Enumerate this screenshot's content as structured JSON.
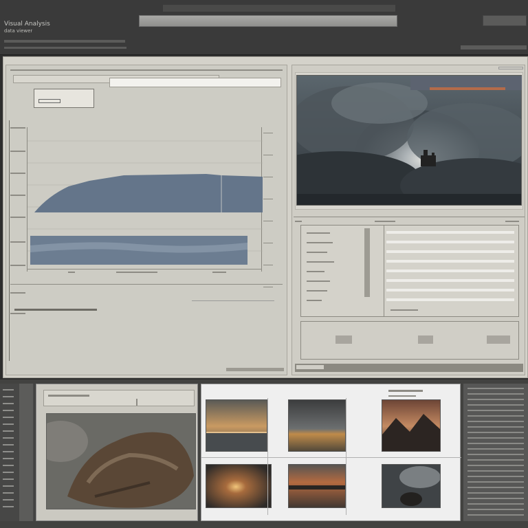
{
  "app": {
    "title": "Visual Analysis",
    "subtitle": "data viewer"
  },
  "toolbar": {
    "search_placeholder": "",
    "right_label": ""
  },
  "left_panel": {
    "header": "",
    "filter_label": "",
    "chart": {
      "caption": "",
      "bottom_label": ""
    }
  },
  "right_panel": {
    "preview_label": "",
    "table": {
      "headers": [
        "",
        "",
        ""
      ],
      "rows": [
        {
          "label": "",
          "value": ""
        },
        {
          "label": "",
          "value": ""
        },
        {
          "label": "",
          "value": ""
        },
        {
          "label": "",
          "value": ""
        },
        {
          "label": "",
          "value": ""
        },
        {
          "label": "",
          "value": ""
        },
        {
          "label": "",
          "value": ""
        },
        {
          "label": "",
          "value": ""
        }
      ]
    }
  },
  "lower": {
    "left_header": "",
    "gallery_header": "",
    "thumbs": [
      "sunset-ocean",
      "dusk-lake",
      "mountain-twilight",
      "fire-horizon",
      "shipwreck-sea",
      "storm-tree"
    ]
  },
  "colors": {
    "chart_fill": "#64758a",
    "accent_orange": "#b46b4a",
    "panel_bg": "#d4d2ca"
  }
}
